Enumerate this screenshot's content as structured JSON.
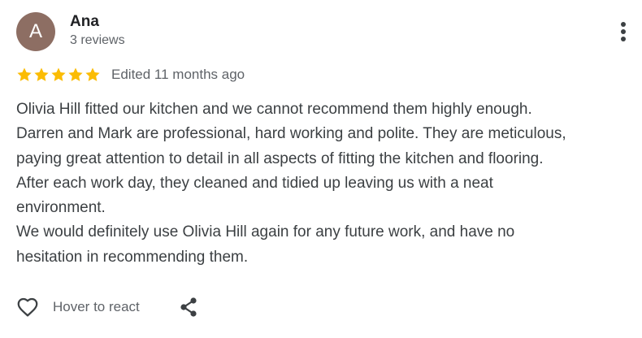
{
  "review": {
    "author": {
      "initial": "A",
      "name": "Ana",
      "review_count": "3 reviews",
      "avatar_color": "#8d6e63"
    },
    "menu_icon": "more-vert-icon",
    "rating": {
      "stars": 5,
      "max": 5,
      "star_color": "#fbbc04",
      "icon": "star-icon"
    },
    "edited": "Edited 11 months ago",
    "text_lines": [
      "Olivia Hill fitted our kitchen and we cannot recommend them highly enough.",
      "Darren and Mark are professional, hard working and polite. They are meticulous,",
      "paying great attention to detail in all aspects of fitting the kitchen and flooring.",
      "After each work day, they cleaned and tidied up leaving us with a neat",
      "environment.",
      "We would definitely use Olivia Hill again for any future work, and have no",
      "hesitation in recommending them."
    ],
    "actions": {
      "react_label": "Hover to react",
      "react_icon": "heart-icon",
      "share_icon": "share-icon"
    }
  },
  "colors": {
    "text_primary": "#202124",
    "text_body": "#3c4043",
    "text_secondary": "#5f6368"
  }
}
